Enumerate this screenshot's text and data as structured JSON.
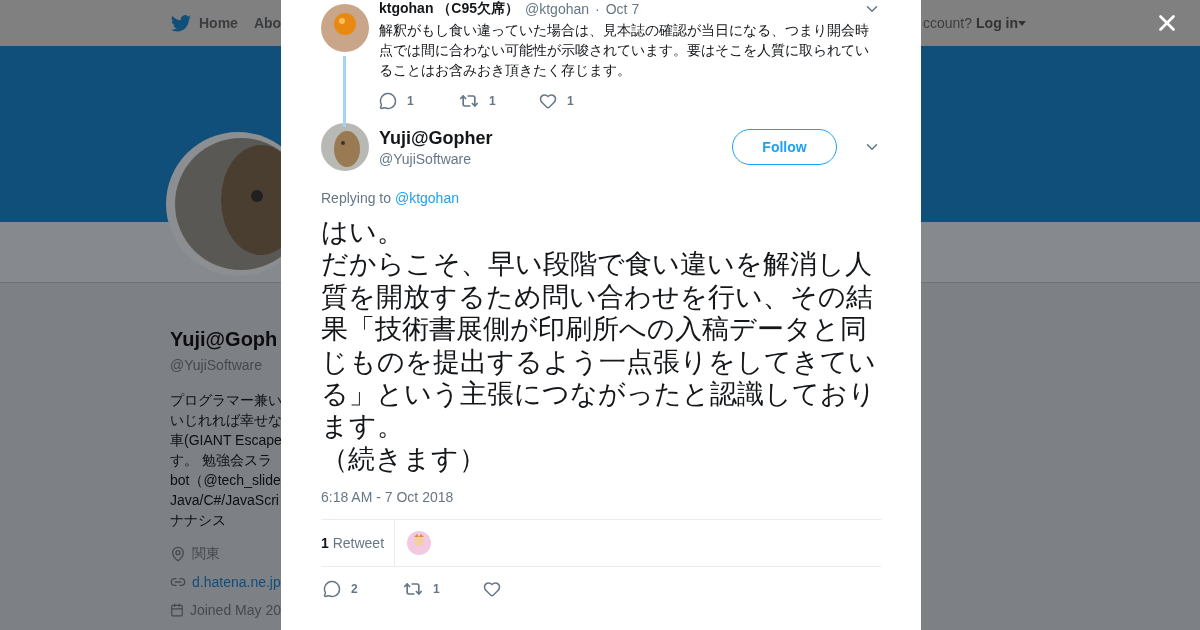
{
  "background_page": {
    "nav": {
      "items": [
        {
          "label": "Home"
        },
        {
          "label": "Abo"
        }
      ],
      "account_prompt": "ccount?",
      "login": "Log in"
    },
    "profile": {
      "name": "Yuji@Goph",
      "handle": "@YujiSoftware",
      "bio_lines": [
        "プログラマー兼い",
        "いじれれば幸せな",
        "車(GIANT Escape",
        "す。 勉強会スラ",
        "bot（@tech_slide",
        "Java/C#/JavaScri",
        "ナナシス"
      ],
      "details": [
        {
          "kind": "location",
          "text": "関東",
          "link": false
        },
        {
          "kind": "url",
          "text": "d.hatena.ne.jp",
          "link": true
        },
        {
          "kind": "joined",
          "text": "Joined May 20",
          "link": false
        }
      ]
    }
  },
  "modal": {
    "parent_tweet": {
      "name": "ktgohan （C95欠席）",
      "handle": "@ktgohan",
      "separator": "·",
      "date": "Oct 7",
      "text": "解釈がもし食い違っていた場合は、見本誌の確認が当日になる、つまり開会時点では間に合わない可能性が示唆されています。要はそこを人質に取られていることはお含みおき頂きたく存じます。",
      "replies": "1",
      "retweets": "1",
      "likes": "1"
    },
    "tweet": {
      "name": "Yuji@Gopher",
      "handle": "@YujiSoftware",
      "follow_label": "Follow",
      "replying_prefix": "Replying to",
      "replying_to": "@ktgohan",
      "paragraphs": [
        "はい。",
        "だからこそ、早い段階で食い違いを解消し人質を開放するため問い合わせを行い、その結果「技術書展側が印刷所への入稿データと同じものを提出するよう一点張りをしてきている」という主張につながったと認識しております。",
        "（続きます）"
      ],
      "timestamp": "6:18 AM - 7 Oct 2018",
      "retweet_count": "1",
      "retweet_label": "Retweet",
      "replies": "2",
      "retweets": "1"
    }
  }
}
